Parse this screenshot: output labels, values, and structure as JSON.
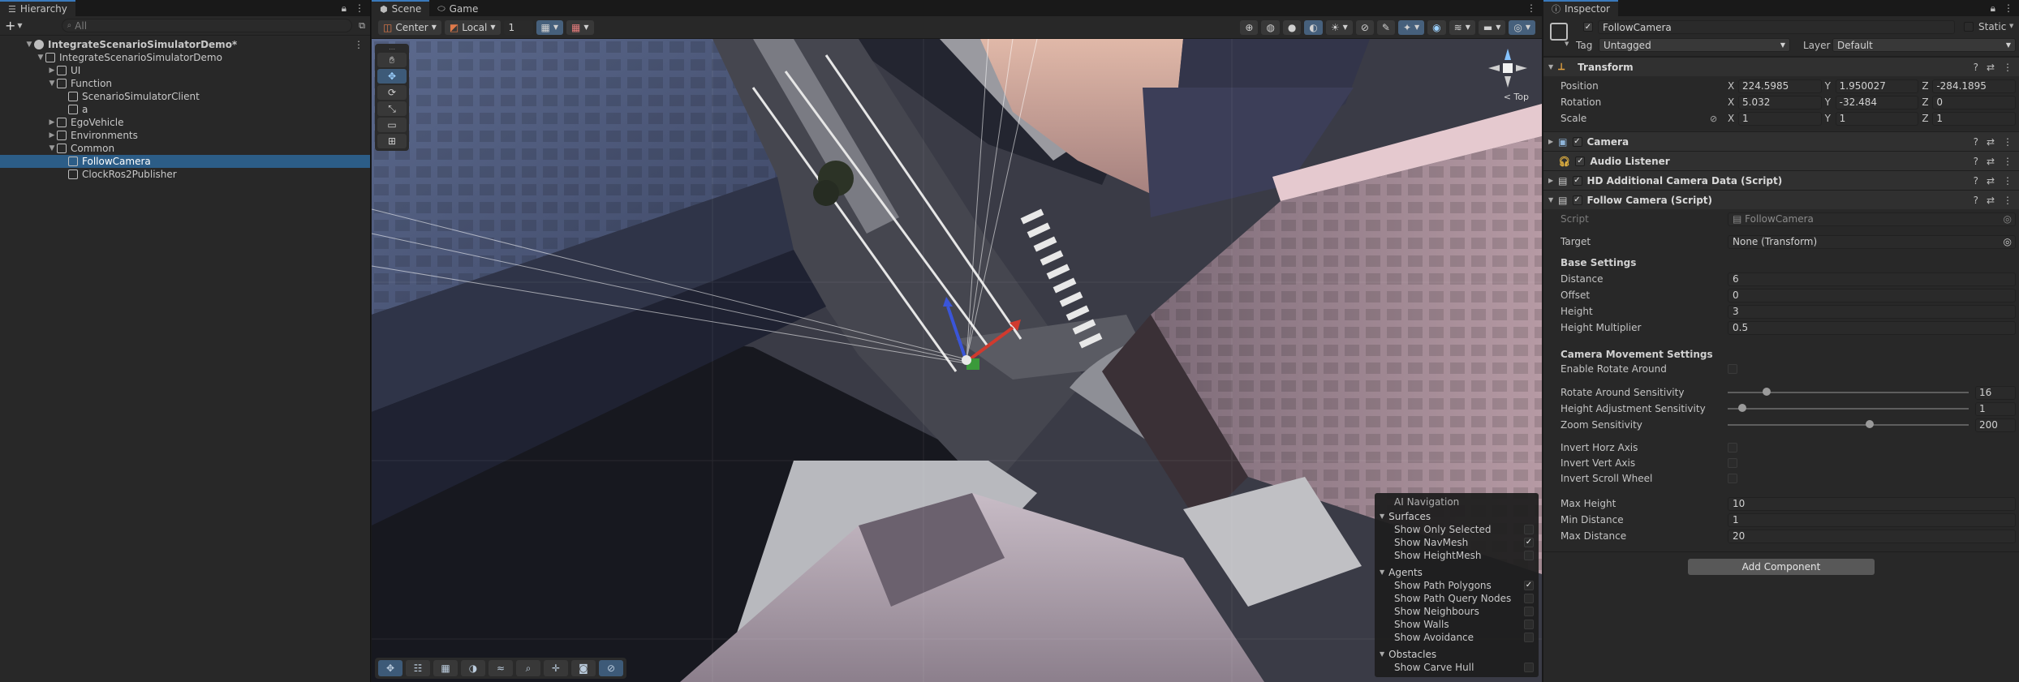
{
  "hierarchy": {
    "tab_label": "Hierarchy",
    "search_placeholder": "All",
    "add_label": "+",
    "items": [
      {
        "label": "IntegrateScenarioSimulatorDemo*",
        "depth": 0,
        "expanded": true,
        "type": "scene"
      },
      {
        "label": "IntegrateScenarioSimulatorDemo",
        "depth": 1,
        "expanded": true
      },
      {
        "label": "UI",
        "depth": 2,
        "expanded": false
      },
      {
        "label": "Function",
        "depth": 2,
        "expanded": true
      },
      {
        "label": "ScenarioSimulatorClient",
        "depth": 3
      },
      {
        "label": "a",
        "depth": 3
      },
      {
        "label": "EgoVehicle",
        "depth": 2,
        "expanded": false
      },
      {
        "label": "Environments",
        "depth": 2,
        "expanded": false
      },
      {
        "label": "Common",
        "depth": 2,
        "expanded": true
      },
      {
        "label": "FollowCamera",
        "depth": 3,
        "selected": true
      },
      {
        "label": "ClockRos2Publisher",
        "depth": 3
      }
    ]
  },
  "scene": {
    "tabs": [
      {
        "label": "Scene",
        "active": true
      },
      {
        "label": "Game",
        "active": false
      }
    ],
    "toolbar": {
      "pivot_label": "Center",
      "space_label": "Local",
      "snap_increment": "1"
    },
    "gizmo_label": "< Top",
    "ai_navigation": {
      "title": "AI Navigation",
      "sections": [
        {
          "label": "Surfaces",
          "options": [
            {
              "label": "Show Only Selected",
              "checked": false
            },
            {
              "label": "Show NavMesh",
              "checked": true
            },
            {
              "label": "Show HeightMesh",
              "checked": false
            }
          ]
        },
        {
          "label": "Agents",
          "options": [
            {
              "label": "Show Path Polygons",
              "checked": true
            },
            {
              "label": "Show Path Query Nodes",
              "checked": false
            },
            {
              "label": "Show Neighbours",
              "checked": false
            },
            {
              "label": "Show Walls",
              "checked": false
            },
            {
              "label": "Show Avoidance",
              "checked": false
            }
          ]
        },
        {
          "label": "Obstacles",
          "options": [
            {
              "label": "Show Carve Hull",
              "checked": false
            }
          ]
        }
      ]
    }
  },
  "inspector": {
    "tab_label": "Inspector",
    "object_name": "FollowCamera",
    "static_label": "Static",
    "tag_label": "Tag",
    "tag_value": "Untagged",
    "layer_label": "Layer",
    "layer_value": "Default",
    "transform": {
      "title": "Transform",
      "position_label": "Position",
      "position": {
        "x": "224.5985",
        "y": "1.950027",
        "z": "-284.1895"
      },
      "rotation_label": "Rotation",
      "rotation": {
        "x": "5.032",
        "y": "-32.484",
        "z": "0"
      },
      "scale_label": "Scale",
      "scale": {
        "x": "1",
        "y": "1",
        "z": "1"
      }
    },
    "components": {
      "camera": "Camera",
      "audio_listener": "Audio Listener",
      "hd_camera_data": "HD Additional Camera Data (Script)",
      "follow_camera": "Follow Camera (Script)"
    },
    "follow_camera": {
      "script_label": "Script",
      "script_value": "FollowCamera",
      "target_label": "Target",
      "target_value": "None (Transform)",
      "base_settings_header": "Base Settings",
      "distance_label": "Distance",
      "distance": "6",
      "offset_label": "Offset",
      "offset": "0",
      "height_label": "Height",
      "height": "3",
      "height_multiplier_label": "Height Multiplier",
      "height_multiplier": "0.5",
      "movement_header": "Camera Movement Settings",
      "enable_rotate_label": "Enable Rotate Around",
      "enable_rotate": false,
      "rotate_sens_label": "Rotate Around Sensitivity",
      "rotate_sens": "16",
      "rotate_sens_fraction": 0.16,
      "height_adj_label": "Height Adjustment Sensitivity",
      "height_adj": "1",
      "height_adj_fraction": 0.06,
      "zoom_sens_label": "Zoom Sensitivity",
      "zoom_sens": "200",
      "zoom_sens_fraction": 0.59,
      "invert_horz_label": "Invert Horz Axis",
      "invert_vert_label": "Invert Vert Axis",
      "invert_scroll_label": "Invert Scroll Wheel",
      "max_height_label": "Max Height",
      "max_height": "10",
      "min_distance_label": "Min Distance",
      "min_distance": "1",
      "max_distance_label": "Max Distance",
      "max_distance": "20"
    },
    "add_component_label": "Add Component"
  },
  "colors": {
    "selection": "#2c5d87",
    "accent": "#3a79bb",
    "panel": "#282828"
  }
}
